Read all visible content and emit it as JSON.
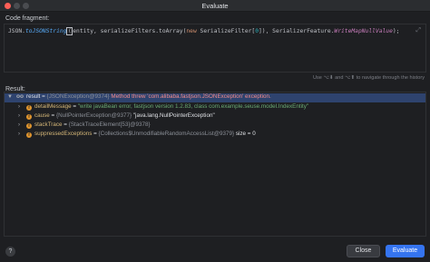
{
  "window": {
    "title": "Evaluate"
  },
  "fragment": {
    "label": "Code fragment:",
    "code": {
      "p1": "JSON.",
      "fn": "toJSONString",
      "caret": "(",
      "p2": "entity, serializeFilters.toArray(",
      "kw": "new",
      "p3": " SerializeFilter[",
      "num": "0",
      "p4": "]), SerializerFeature.",
      "const": "WriteMapNullValue",
      "p5": ");"
    }
  },
  "hint": "Use ⌥⬇ and ⌥⬆ to navigate through the history",
  "result": {
    "label": "Result:",
    "rows": [
      {
        "arrow": "▼",
        "icon": "oo",
        "name": "result",
        "eq": " = ",
        "ref": "{JSONException@9374} ",
        "msg": "Method threw 'com.alibaba.fastjson.JSONException' exception."
      },
      {
        "arrow": "›",
        "icon": "f",
        "name": "detailMessage",
        "eq": " = ",
        "value": "\"write javaBean error, fastjson version 1.2.83, class com.example.seuse.model.IndexEntity\""
      },
      {
        "arrow": "›",
        "icon": "f",
        "name": "cause",
        "eq": " = ",
        "ref": "{NullPointerException@9377} ",
        "value": "\"java.lang.NullPointerException\""
      },
      {
        "arrow": "›",
        "icon": "f",
        "name": "stackTrace",
        "eq": " = ",
        "ref": "{StackTraceElement[53]@9378}"
      },
      {
        "arrow": "›",
        "icon": "f",
        "name": "suppressedExceptions",
        "eq": " = ",
        "ref": "{Collections$UnmodifiableRandomAccessList@9379} ",
        "value": " size = 0"
      }
    ]
  },
  "buttons": {
    "help": "?",
    "close": "Close",
    "evaluate": "Evaluate"
  },
  "colors": {
    "accent": "#3574f0",
    "selection": "#2e436e",
    "field_icon": "#e0952e",
    "error_text": "#f28a8a"
  }
}
